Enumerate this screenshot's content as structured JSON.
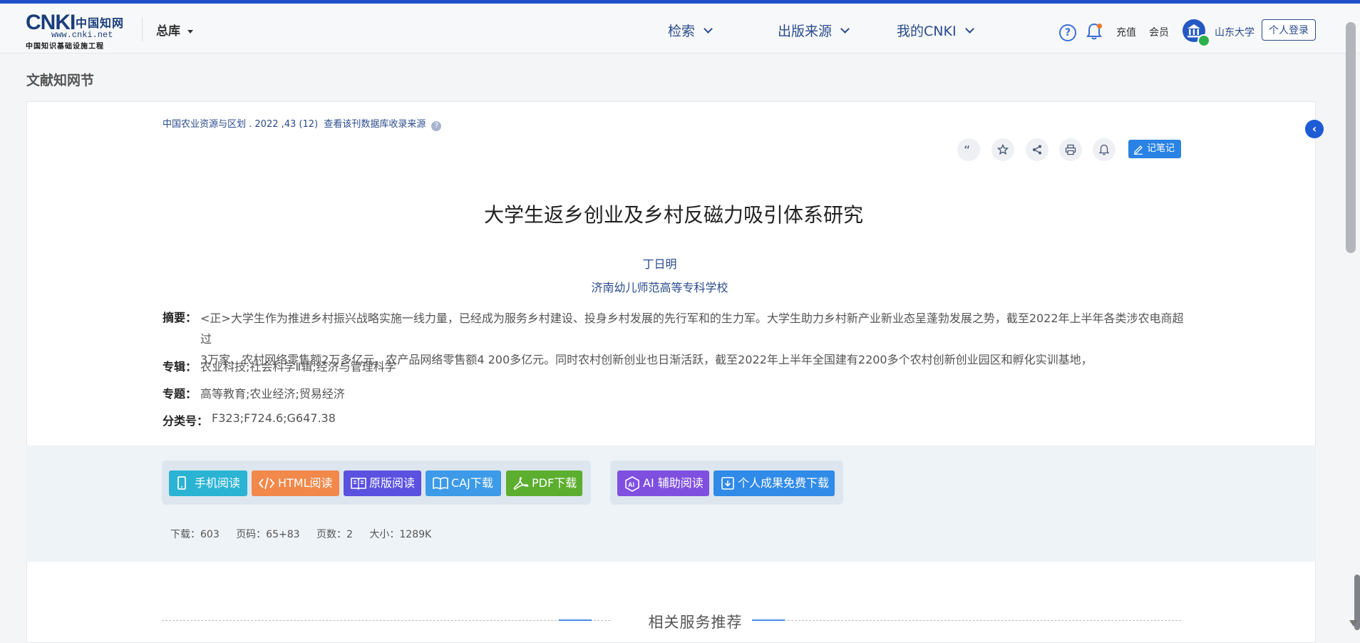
{
  "header": {
    "logo": {
      "main": "CNKI",
      "cn": "中国知网",
      "url": "www.cnki.net",
      "sub": "中国知识基础设施工程"
    },
    "library_select": "总库",
    "nav": [
      "检索",
      "出版来源",
      "我的CNKI"
    ],
    "recharge": "充值",
    "member": "会员",
    "institution": "山东大学",
    "login_button": "个人登录"
  },
  "page_title": "文献知网节",
  "article": {
    "source": "中国农业资源与区划 .  2022 ,43 (12)",
    "source_link": "查看该刊数据库收录来源",
    "notes_button": "记笔记",
    "title": "大学生返乡创业及乡村反磁力吸引体系研究",
    "author": "丁日明",
    "organization": "济南幼儿师范高等专科学校",
    "abstract_label": "摘要：",
    "abstract_line1": "<正>大学生作为推进乡村振兴战略实施一线力量，已经成为服务乡村建设、投身乡村发展的先行军和的生力军。大学生助力乡村新产业新业态呈蓬勃发展之势，截至2022年上半年各类涉农电商超过",
    "abstract_line2": "3万家、农村网络零售额2万多亿元、农产品网络零售额4 200多亿元。同时农村创新创业也日渐活跃，截至2022年上半年全国建有2200多个农村创新创业园区和孵化实训基地，",
    "series_label": "专辑：",
    "series": "农业科技;社会科学Ⅱ辑;经济与管理科学",
    "topic_label": "专题：",
    "topic": "高等教育;农业经济;贸易经济",
    "class_label": "分类号：",
    "class_no": "F323;F724.6;G647.38"
  },
  "actions": {
    "mobile": "手机阅读",
    "html": "HTML阅读",
    "original": "原版阅读",
    "caj": "CAJ下载",
    "pdf": "PDF下载",
    "ai": "AI 辅助阅读",
    "personal": "个人成果免费下载"
  },
  "stats": {
    "downloads": "下载：603",
    "pages_code": "页码：65+83",
    "page_count": "页数：2",
    "size": "大小：1289K"
  },
  "recommend_title": "相关服务推荐",
  "colors": {
    "accent": "#1e50c8",
    "link": "#2a4b8d",
    "mobile": "#2bb3d3",
    "html": "#f2884a",
    "original": "#5a51e0",
    "caj": "#3c9ae8",
    "pdf": "#5cae2e",
    "ai": "#7f4fe0",
    "personal": "#2f8ae8"
  }
}
